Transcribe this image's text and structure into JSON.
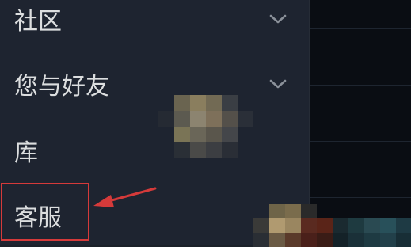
{
  "menu": {
    "items": [
      {
        "label": "社区",
        "icon": "chevron-down-icon"
      },
      {
        "label": "您与好友",
        "icon": "chevron-down-icon"
      },
      {
        "label": "库"
      },
      {
        "label": "客服"
      }
    ]
  },
  "annotation": {
    "highlight_color": "#d53a3a",
    "highlighted_item": "客服"
  },
  "colors": {
    "menu_background": "#1e2430",
    "menu_text": "#dcdedf",
    "content_background": "#0a0d13"
  }
}
